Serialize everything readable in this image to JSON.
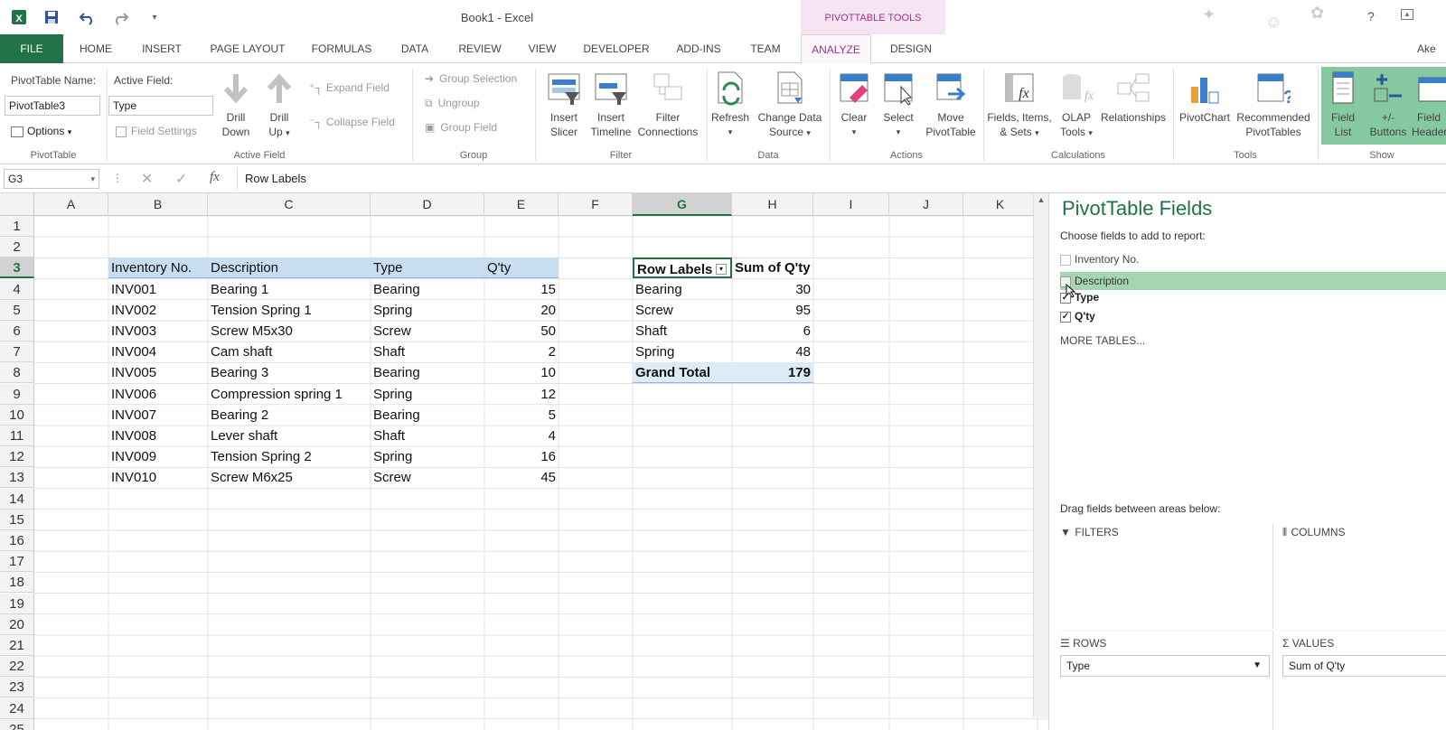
{
  "window": {
    "title": "Book1 - Excel",
    "context_tab_group": "PIVOTTABLE TOOLS",
    "help": "?",
    "user": "Ake"
  },
  "tabs": [
    "FILE",
    "HOME",
    "INSERT",
    "PAGE LAYOUT",
    "FORMULAS",
    "DATA",
    "REVIEW",
    "VIEW",
    "DEVELOPER",
    "ADD-INS",
    "TEAM",
    "ANALYZE",
    "DESIGN"
  ],
  "ribbon": {
    "pivottable": {
      "name_label": "PivotTable Name:",
      "name_value": "PivotTable3",
      "options": "Options",
      "group": "PivotTable"
    },
    "active_field": {
      "label": "Active Field:",
      "value": "Type",
      "field_settings": "Field Settings",
      "drill_down": [
        "Drill",
        "Down"
      ],
      "drill_up": [
        "Drill",
        "Up"
      ],
      "expand": "Expand Field",
      "collapse": "Collapse Field",
      "group": "Active Field"
    },
    "group": {
      "group_selection": "Group Selection",
      "ungroup": "Ungroup",
      "group_field": "Group Field",
      "group": "Group"
    },
    "filter": {
      "insert_slicer": [
        "Insert",
        "Slicer"
      ],
      "insert_timeline": [
        "Insert",
        "Timeline"
      ],
      "filter_connections": [
        "Filter",
        "Connections"
      ],
      "group": "Filter"
    },
    "data": {
      "refresh": "Refresh",
      "change_source": [
        "Change Data",
        "Source"
      ],
      "group": "Data"
    },
    "actions": {
      "clear": "Clear",
      "select": "Select",
      "move": [
        "Move",
        "PivotTable"
      ],
      "group": "Actions"
    },
    "calculations": {
      "fields_items": [
        "Fields, Items,",
        "& Sets"
      ],
      "olap": [
        "OLAP",
        "Tools"
      ],
      "relationships": "Relationships",
      "group": "Calculations"
    },
    "tools": {
      "pivotchart": "PivotChart",
      "recommended": [
        "Recommended",
        "PivotTables"
      ],
      "group": "Tools"
    },
    "show": {
      "field_list": [
        "Field",
        "List"
      ],
      "buttons": [
        "+/-",
        "Buttons"
      ],
      "headers": [
        "Field",
        "Headers"
      ],
      "group": "Show"
    }
  },
  "formula_bar": {
    "name_box": "G3",
    "fx": "fx",
    "content": "Row Labels"
  },
  "grid": {
    "columns": [
      "A",
      "B",
      "C",
      "D",
      "E",
      "F",
      "G",
      "H",
      "I",
      "J",
      "K"
    ],
    "rows": [
      "1",
      "2",
      "3",
      "4",
      "5",
      "6",
      "7",
      "8",
      "9",
      "10",
      "11",
      "12",
      "13",
      "14",
      "15",
      "16",
      "17",
      "18",
      "19",
      "20",
      "21",
      "22",
      "23",
      "24",
      "25"
    ],
    "source_headers": [
      "Inventory No.",
      "Description",
      "Type",
      "Q'ty"
    ],
    "source_rows": [
      [
        "INV001",
        "Bearing 1",
        "Bearing",
        "15"
      ],
      [
        "INV002",
        "Tension Spring 1",
        "Spring",
        "20"
      ],
      [
        "INV003",
        "Screw M5x30",
        "Screw",
        "50"
      ],
      [
        "INV004",
        "Cam shaft",
        "Shaft",
        "2"
      ],
      [
        "INV005",
        "Bearing 3",
        "Bearing",
        "10"
      ],
      [
        "INV006",
        "Compression spring 1",
        "Spring",
        "12"
      ],
      [
        "INV007",
        "Bearing 2",
        "Bearing",
        "5"
      ],
      [
        "INV008",
        "Lever shaft",
        "Shaft",
        "4"
      ],
      [
        "INV009",
        "Tension Spring 2",
        "Spring",
        "16"
      ],
      [
        "INV010",
        "Screw M6x25",
        "Screw",
        "45"
      ]
    ],
    "pivot_headers": [
      "Row Labels",
      "Sum of Q'ty"
    ],
    "pivot_rows": [
      [
        "Bearing",
        "30"
      ],
      [
        "Screw",
        "95"
      ],
      [
        "Shaft",
        "6"
      ],
      [
        "Spring",
        "48"
      ]
    ],
    "pivot_total": [
      "Grand Total",
      "179"
    ]
  },
  "pane": {
    "title": "PivotTable Fields",
    "subtitle": "Choose fields to add to report:",
    "fields": [
      {
        "name": "Inventory No.",
        "checked": false
      },
      {
        "name": "Description",
        "checked": false
      },
      {
        "name": "Type",
        "checked": true
      },
      {
        "name": "Q'ty",
        "checked": true
      }
    ],
    "more_tables": "MORE TABLES...",
    "drag_label": "Drag fields between areas below:",
    "areas": {
      "filters": "FILTERS",
      "columns": "COLUMNS",
      "rows": "ROWS",
      "values": "VALUES"
    },
    "rows_item": "Type",
    "values_item": "Sum of Q'ty"
  },
  "colors": {
    "excel_green": "#217346",
    "analyze_pink": "#a3308e",
    "header_blue": "#c9ddf0"
  }
}
